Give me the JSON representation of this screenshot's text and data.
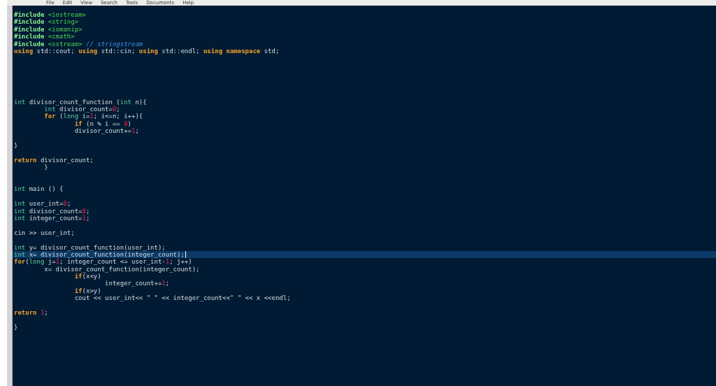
{
  "menu": [
    "File",
    "Edit",
    "View",
    "Search",
    "Tools",
    "Documents",
    "Help"
  ],
  "lines": [
    {
      "current": false,
      "tokens": [
        {
          "kind": "preproc",
          "text": "#include"
        },
        {
          "kind": "header",
          "text": " <iostream>"
        }
      ]
    },
    {
      "current": false,
      "tokens": [
        {
          "kind": "preproc",
          "text": "#include"
        },
        {
          "kind": "header",
          "text": " <string>"
        }
      ]
    },
    {
      "current": false,
      "tokens": [
        {
          "kind": "preproc",
          "text": "#include"
        },
        {
          "kind": "header",
          "text": " <iomanip>"
        }
      ]
    },
    {
      "current": false,
      "tokens": [
        {
          "kind": "preproc",
          "text": "#include"
        },
        {
          "kind": "header",
          "text": " <cmath>"
        }
      ]
    },
    {
      "current": false,
      "tokens": [
        {
          "kind": "preproc",
          "text": "#include"
        },
        {
          "kind": "header",
          "text": " <sstream>"
        },
        {
          "kind": "comment",
          "text": " // stringstream"
        }
      ]
    },
    {
      "current": false,
      "tokens": [
        {
          "kind": "keyword",
          "text": "using"
        },
        {
          "kind": "plain",
          "text": " std::cout; "
        },
        {
          "kind": "keyword",
          "text": "using"
        },
        {
          "kind": "plain",
          "text": " std::cin; "
        },
        {
          "kind": "keyword",
          "text": "using"
        },
        {
          "kind": "plain",
          "text": " std::endl; "
        },
        {
          "kind": "keyword",
          "text": "using"
        },
        {
          "kind": "keyword",
          "text": " namespace"
        },
        {
          "kind": "plain",
          "text": " std;"
        }
      ]
    },
    {
      "current": false
    },
    {
      "current": false
    },
    {
      "current": false
    },
    {
      "current": false
    },
    {
      "current": false
    },
    {
      "current": false
    },
    {
      "current": false,
      "tokens": [
        {
          "kind": "type",
          "text": "int"
        },
        {
          "kind": "plain",
          "text": " divisor_count_function ("
        },
        {
          "kind": "type",
          "text": "int"
        },
        {
          "kind": "plain",
          "text": " n){"
        }
      ]
    },
    {
      "current": false,
      "tokens": [
        {
          "kind": "type",
          "text": "\tint"
        },
        {
          "kind": "plain",
          "text": " divisor_count="
        },
        {
          "kind": "number",
          "text": "0"
        },
        {
          "kind": "plain",
          "text": ";"
        }
      ]
    },
    {
      "current": false,
      "tokens": [
        {
          "kind": "keyword",
          "text": "\tfor"
        },
        {
          "kind": "plain",
          "text": " ("
        },
        {
          "kind": "type",
          "text": "long"
        },
        {
          "kind": "plain",
          "text": " i="
        },
        {
          "kind": "number",
          "text": "1"
        },
        {
          "kind": "plain",
          "text": "; i<=n; i++){"
        }
      ]
    },
    {
      "current": false,
      "tokens": [
        {
          "kind": "keyword",
          "text": "\t\tif"
        },
        {
          "kind": "plain",
          "text": " (n % i == "
        },
        {
          "kind": "number",
          "text": "0"
        },
        {
          "kind": "plain",
          "text": ")"
        }
      ]
    },
    {
      "current": false,
      "tokens": [
        {
          "kind": "plain",
          "text": "\t\tdivisor_count+="
        },
        {
          "kind": "number",
          "text": "1"
        },
        {
          "kind": "plain",
          "text": ";"
        }
      ]
    },
    {
      "current": false
    },
    {
      "current": false,
      "tokens": [
        {
          "kind": "plain",
          "text": "}"
        }
      ]
    },
    {
      "current": false
    },
    {
      "current": false,
      "tokens": [
        {
          "kind": "keyword",
          "text": "return"
        },
        {
          "kind": "plain",
          "text": " divisor_count;"
        }
      ]
    },
    {
      "current": false,
      "tokens": [
        {
          "kind": "plain",
          "text": "\t}"
        }
      ]
    },
    {
      "current": false
    },
    {
      "current": false
    },
    {
      "current": false,
      "tokens": [
        {
          "kind": "type",
          "text": "int"
        },
        {
          "kind": "plain",
          "text": " main () {"
        }
      ]
    },
    {
      "current": false
    },
    {
      "current": false,
      "tokens": [
        {
          "kind": "type",
          "text": "int"
        },
        {
          "kind": "plain",
          "text": " user_int="
        },
        {
          "kind": "number",
          "text": "0"
        },
        {
          "kind": "plain",
          "text": ";"
        }
      ]
    },
    {
      "current": false,
      "tokens": [
        {
          "kind": "type",
          "text": "int"
        },
        {
          "kind": "plain",
          "text": " divisor_count="
        },
        {
          "kind": "number",
          "text": "0"
        },
        {
          "kind": "plain",
          "text": ";"
        }
      ]
    },
    {
      "current": false,
      "tokens": [
        {
          "kind": "type",
          "text": "int"
        },
        {
          "kind": "plain",
          "text": " integer_count="
        },
        {
          "kind": "number",
          "text": "1"
        },
        {
          "kind": "plain",
          "text": ";"
        }
      ]
    },
    {
      "current": false
    },
    {
      "current": false,
      "tokens": [
        {
          "kind": "plain",
          "text": "cin >> user_int;"
        }
      ]
    },
    {
      "current": false
    },
    {
      "current": false,
      "tokens": [
        {
          "kind": "type",
          "text": "int"
        },
        {
          "kind": "plain",
          "text": " y= divisor_count_function(user_int);"
        }
      ]
    },
    {
      "current": true,
      "tokens": [
        {
          "kind": "type",
          "text": "int"
        },
        {
          "kind": "plain",
          "text": " x= divisor_count_function(integer_count);"
        }
      ]
    },
    {
      "current": false,
      "tokens": [
        {
          "kind": "keyword",
          "text": "for"
        },
        {
          "kind": "plain",
          "text": "("
        },
        {
          "kind": "type",
          "text": "long"
        },
        {
          "kind": "plain",
          "text": " j="
        },
        {
          "kind": "number",
          "text": "1"
        },
        {
          "kind": "plain",
          "text": "; integer_count <= user_int-"
        },
        {
          "kind": "number",
          "text": "1"
        },
        {
          "kind": "plain",
          "text": "; j++)"
        }
      ]
    },
    {
      "current": false,
      "tokens": [
        {
          "kind": "plain",
          "text": "\tx= divisor_count_function(integer_count);"
        }
      ]
    },
    {
      "current": false,
      "tokens": [
        {
          "kind": "keyword",
          "text": "\t\tif"
        },
        {
          "kind": "plain",
          "text": "(x<y)"
        }
      ]
    },
    {
      "current": false,
      "tokens": [
        {
          "kind": "plain",
          "text": "\t\t\tinteger_count+="
        },
        {
          "kind": "number",
          "text": "1"
        },
        {
          "kind": "plain",
          "text": ";"
        }
      ]
    },
    {
      "current": false,
      "tokens": [
        {
          "kind": "keyword",
          "text": "\t\tif"
        },
        {
          "kind": "plain",
          "text": "(x>y)"
        }
      ]
    },
    {
      "current": false,
      "tokens": [
        {
          "kind": "plain",
          "text": "\t\tcout << user_int<< \" \" << integer_count<<\" \" << x <<endl;"
        }
      ]
    },
    {
      "current": false
    },
    {
      "current": false,
      "tokens": [
        {
          "kind": "keyword",
          "text": "return"
        },
        {
          "kind": "number",
          "text": " 1"
        },
        {
          "kind": "plain",
          "text": ";"
        }
      ]
    },
    {
      "current": false
    },
    {
      "current": false,
      "tokens": [
        {
          "kind": "plain",
          "text": "}"
        }
      ]
    }
  ]
}
